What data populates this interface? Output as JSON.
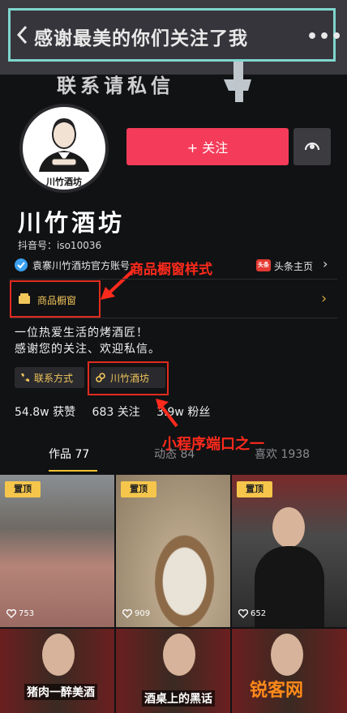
{
  "banner": {
    "text": "感谢最美的你们关注了我",
    "more": "•••"
  },
  "contact_note": "联系请私信",
  "avatar": {
    "label": "川竹酒坊"
  },
  "follow_button": "+ 关注",
  "profile": {
    "name": "川竹酒坊",
    "douyin_id": "抖音号：iso10036",
    "verify_text": "袁寨川竹酒坊官方账号",
    "toutiao_badge": "头条",
    "toutiao_label": "头条主页"
  },
  "shop": {
    "label": "商品橱窗",
    "chevron": "›"
  },
  "annotations": {
    "shop_style": "商品橱窗样式",
    "mini_program": "小程序端口之一"
  },
  "bio": {
    "line1": "一位热爱生活的烤酒匠！",
    "line2": "感谢您的关注、欢迎私信。"
  },
  "pills": {
    "contact": "联系方式",
    "mini_program": "川竹酒坊"
  },
  "stats": {
    "likes": "54.8w 获赞",
    "following": "683 关注",
    "fans": "3.9w 粉丝"
  },
  "tabs": [
    {
      "label": "作品 77"
    },
    {
      "label": "动态 84"
    },
    {
      "label": "喜欢 1938"
    }
  ],
  "tiles": [
    {
      "pin": "置顶",
      "likes": "753"
    },
    {
      "pin": "置顶",
      "likes": "909"
    },
    {
      "pin": "置顶",
      "likes": "652"
    },
    {
      "caption": "猪肉一醉美酒"
    },
    {
      "caption": "酒桌上的黑话"
    },
    {
      "watermark": "锐客网"
    }
  ],
  "colors": {
    "accent": "#f43c5a",
    "highlight": "#e32b1f",
    "gold": "#f2c230"
  }
}
